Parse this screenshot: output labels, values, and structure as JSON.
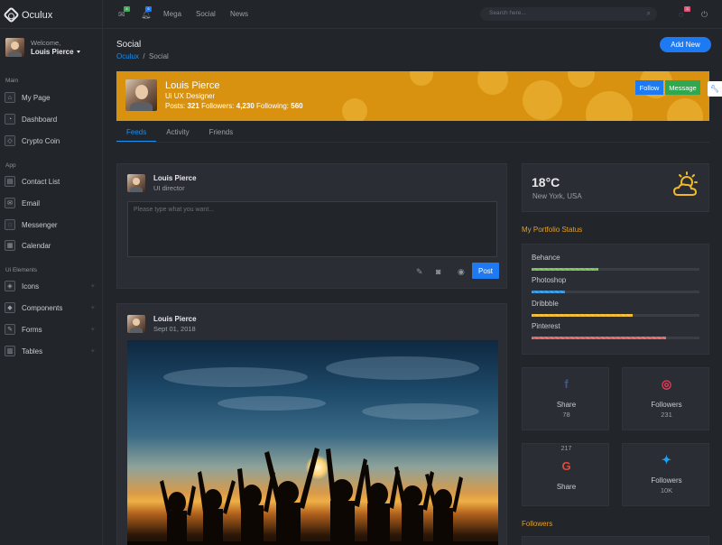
{
  "app": {
    "name": "Oculux"
  },
  "user": {
    "welcome": "Welcome,",
    "name": "Louis Pierce"
  },
  "sidebar": {
    "groups": {
      "main": "Main",
      "app": "App",
      "ui": "Ui Elements"
    },
    "main_items": [
      {
        "label": "My Page",
        "icon": "home-icon"
      },
      {
        "label": "Dashboard",
        "icon": "dashboard-icon"
      },
      {
        "label": "Crypto Coin",
        "icon": "gem-icon"
      }
    ],
    "app_items": [
      {
        "label": "Contact List",
        "icon": "contacts-icon"
      },
      {
        "label": "Email",
        "icon": "email-icon"
      },
      {
        "label": "Messenger",
        "icon": "chat-icon"
      },
      {
        "label": "Calendar",
        "icon": "calendar-icon"
      }
    ],
    "ui_items": [
      {
        "label": "Icons",
        "icon": "tag-icon"
      },
      {
        "label": "Components",
        "icon": "diamond-icon"
      },
      {
        "label": "Forms",
        "icon": "pencil-icon"
      },
      {
        "label": "Tables",
        "icon": "table-icon"
      }
    ]
  },
  "topbar": {
    "mail_badge": "4",
    "bell_badge": "6",
    "links": [
      "Mega",
      "Social",
      "News"
    ],
    "search_placeholder": "Search here...",
    "chat_badge": "3"
  },
  "page": {
    "title": "Social",
    "breadcrumb_root": "Oculux",
    "breadcrumb_current": "Social",
    "add_button": "Add New"
  },
  "banner": {
    "name": "Louis Pierce",
    "role": "Ui UX Designer",
    "posts_label": "Posts:",
    "posts": "321",
    "followers_label": "Followers:",
    "followers": "4,230",
    "following_label": "Following:",
    "following": "560",
    "follow_button": "Follow",
    "message_button": "Message",
    "accent": "#d9920f"
  },
  "tabs": [
    {
      "label": "Feeds",
      "active": true
    },
    {
      "label": "Activity",
      "active": false
    },
    {
      "label": "Friends",
      "active": false
    }
  ],
  "composer": {
    "name": "Louis Pierce",
    "role": "UI director",
    "placeholder": "Please type what you want...",
    "post_button": "Post"
  },
  "post": {
    "name": "Louis Pierce",
    "date": "Sept 01, 2018"
  },
  "weather": {
    "temperature": "18°C",
    "location": "New York, USA",
    "icon": "sun-cloud-icon"
  },
  "portfolio": {
    "title": "My Portfolio Status",
    "items": [
      {
        "label": "Behance",
        "percent": 40,
        "color": "#6fbf4a"
      },
      {
        "label": "Photoshop",
        "percent": 20,
        "color": "#2f8fd8"
      },
      {
        "label": "Dribbble",
        "percent": 60,
        "color": "#f0b829"
      },
      {
        "label": "Pinterest",
        "percent": 80,
        "color": "#e05d5d"
      }
    ]
  },
  "stats": [
    {
      "icon": "facebook-icon",
      "label": "Share",
      "value": "78",
      "color": "#3b5998"
    },
    {
      "icon": "instagram-icon",
      "label": "Followers",
      "value": "231",
      "color": "#e4405f"
    },
    {
      "icon": "google-icon",
      "label": "Share",
      "value": "217",
      "color": "#dd4b39"
    },
    {
      "icon": "twitter-icon",
      "label": "Followers",
      "value": "10K",
      "color": "#1da1f2"
    }
  ],
  "followers_title": "Followers"
}
